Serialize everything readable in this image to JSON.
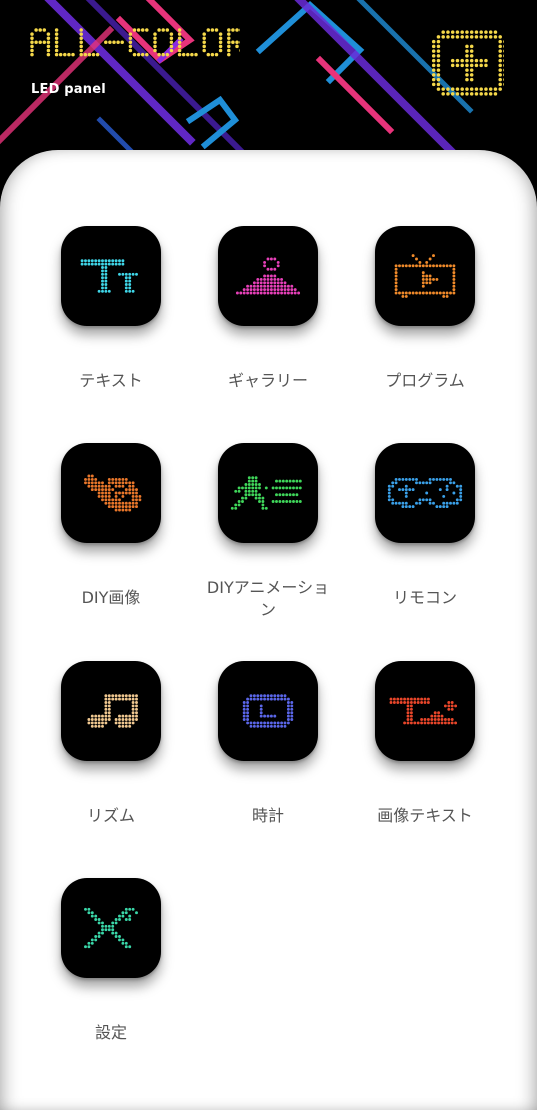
{
  "header": {
    "title": "ALL-COLOR",
    "subtitle": "LED panel",
    "add_icon": "plus-icon"
  },
  "accent_colors": {
    "title_yellow": "#f5d84a",
    "pink": "#e8337a",
    "blue": "#1f8fd8",
    "purple": "#6a2bd9"
  },
  "menu": [
    {
      "label": "テキスト",
      "icon": "text-icon",
      "color": "#3fd6e8"
    },
    {
      "label": "ギャラリー",
      "icon": "gallery-icon",
      "color": "#e640b8"
    },
    {
      "label": "プログラム",
      "icon": "program-tv-icon",
      "color": "#f08a2a"
    },
    {
      "label": "DIY画像",
      "icon": "paint-palette-icon",
      "color": "#e8762a"
    },
    {
      "label": "DIYアニメーション",
      "icon": "running-man-icon",
      "color": "#3fd65a"
    },
    {
      "label": "リモコン",
      "icon": "gamepad-icon",
      "color": "#3aa0e8"
    },
    {
      "label": "リズム",
      "icon": "music-note-icon",
      "color": "#f0c890"
    },
    {
      "label": "時計",
      "icon": "clock-icon",
      "color": "#5a66e8"
    },
    {
      "label": "画像テキスト",
      "icon": "image-text-icon",
      "color": "#e8462a"
    },
    {
      "label": "設定",
      "icon": "settings-tools-icon",
      "color": "#3ad6a8"
    }
  ]
}
